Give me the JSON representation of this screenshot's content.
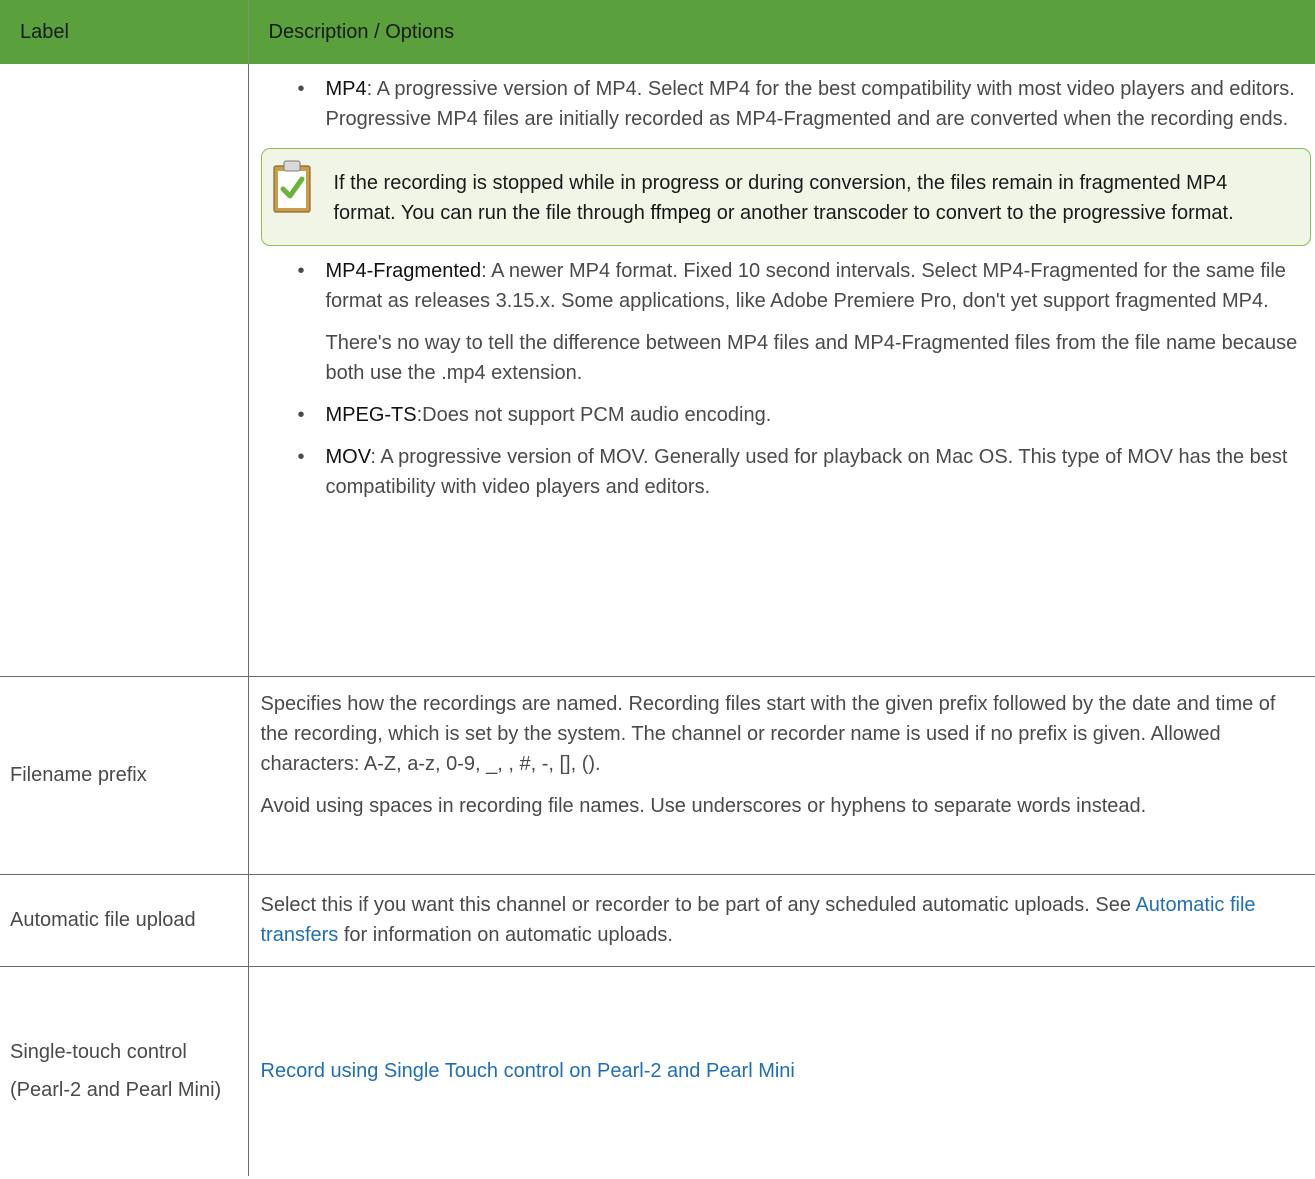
{
  "header": {
    "label_col": "Label",
    "desc_col": "Description / Options"
  },
  "row1": {
    "mp4_term": "MP4",
    "mp4_text": ": A progressive version of MP4. Select MP4 for the best compatibility with most video players and editors. Progressive MP4 files are initially recorded as MP4-Fragmented and are converted when the recording ends.",
    "note_text_1": "If the recording is stopped while in progress or during conversion, the files remain in fragmented MP4 format. You can run the file through ",
    "note_term": "ffmpeg",
    "note_text_2": " or another transcoder to convert to the progressive format.",
    "frag_term": "MP4-Fragmented",
    "frag_text": ": A newer MP4 format. Fixed 10 second intervals. Select MP4-Fragmented for the same file format as releases 3.15.x. Some applications, like Adobe Premiere Pro, don't yet support fragmented MP4.",
    "frag_extra": "There's no way to tell the difference between MP4 files and MP4-Fragmented files from the file name because both use the .mp4 extension.",
    "ts_term": "MPEG-TS",
    "ts_text": ":Does not support PCM audio encoding.",
    "mov_term": "MOV",
    "mov_text": ": A progressive version of MOV. Generally used for playback on Mac OS. This type of MOV has the best compatibility with video players and editors.",
    "bullet": "•",
    "note_icon": "clipboard-check-icon"
  },
  "row2": {
    "label": "Filename prefix",
    "p1": "Specifies how the recordings are named. Recording files start with the given prefix followed by the date and time of the recording, which is set by the system. The channel or recorder name is used if no prefix is given. Allowed characters: A-Z, a-z, 0-9, _, , #, -, [], ().",
    "p2": "Avoid using spaces in recording file names. Use underscores or hyphens to separate words instead."
  },
  "row3": {
    "label": "Automatic file upload",
    "text1": "Select this if you want this channel or recorder to be part of any scheduled automatic uploads. See ",
    "link": "Automatic file transfers",
    "text2": " for information on automatic uploads."
  },
  "row4": {
    "label1": "Single-touch control",
    "label2": "(Pearl-2 and Pearl Mini)",
    "link": "Record using Single Touch control on Pearl-2 and Pearl Mini"
  },
  "colors": {
    "header_bg": "#5aa03c",
    "note_bg": "#f0f5e6",
    "note_border": "#8cc04f",
    "link": "#1f6fb5"
  }
}
